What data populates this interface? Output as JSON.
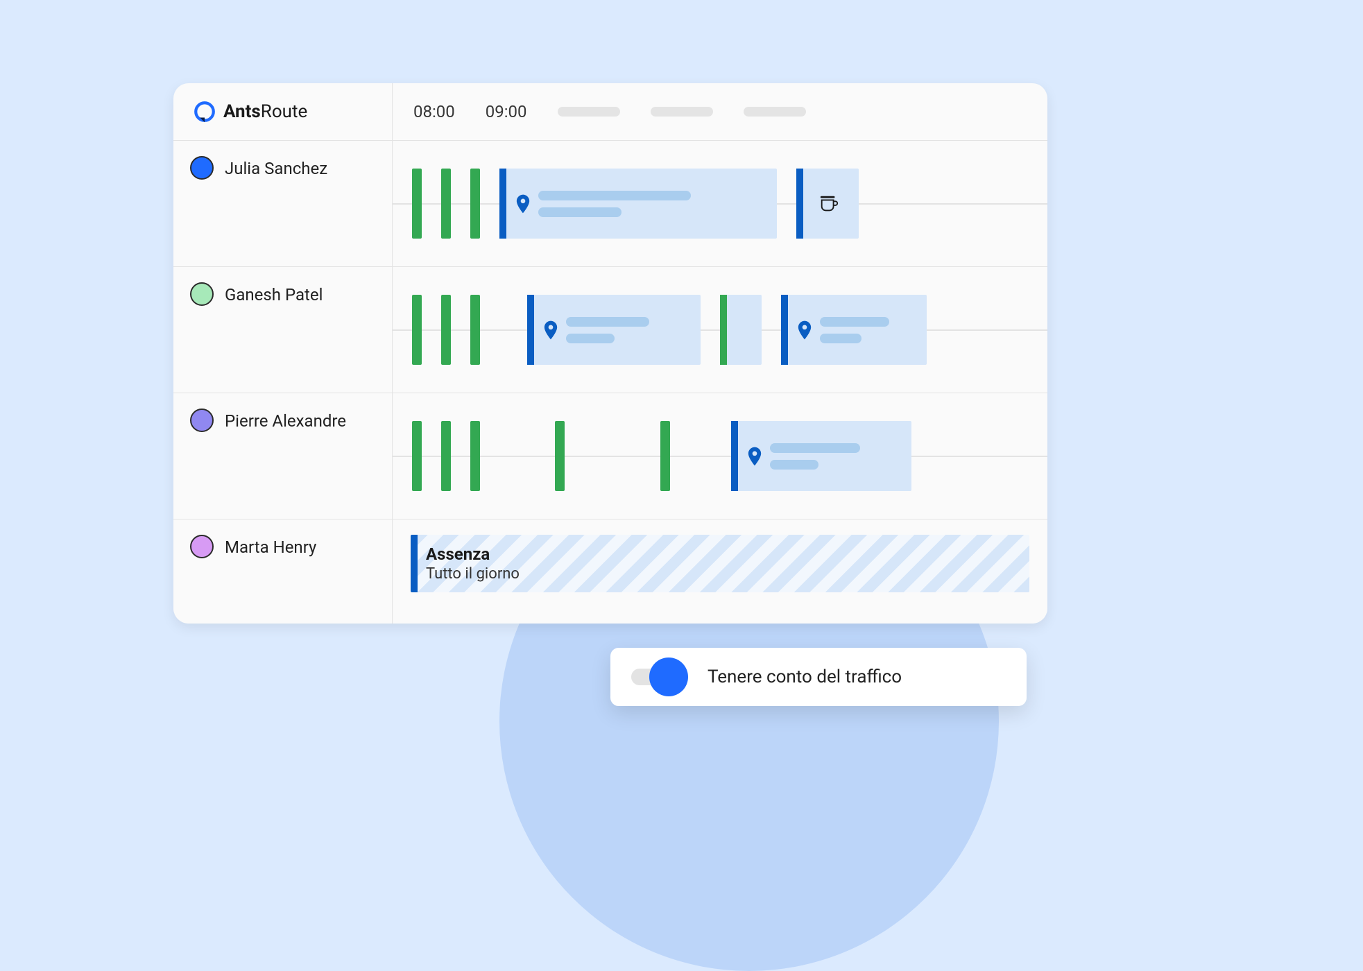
{
  "brand": {
    "bold": "Ants",
    "light": "Route"
  },
  "time_header": {
    "t1": "08:00",
    "t2": "09:00"
  },
  "agents": [
    {
      "name": "Julia Sanchez",
      "color": "#1f6bff"
    },
    {
      "name": "Ganesh Patel",
      "color": "#a7e9b9"
    },
    {
      "name": "Pierre Alexandre",
      "color": "#9088f1"
    },
    {
      "name": "Marta Henry",
      "color": "#d79bf4"
    }
  ],
  "absence": {
    "title": "Assenza",
    "sub": "Tutto il giorno"
  },
  "traffic_toggle": {
    "label": "Tenere conto del traffico",
    "on": true
  }
}
